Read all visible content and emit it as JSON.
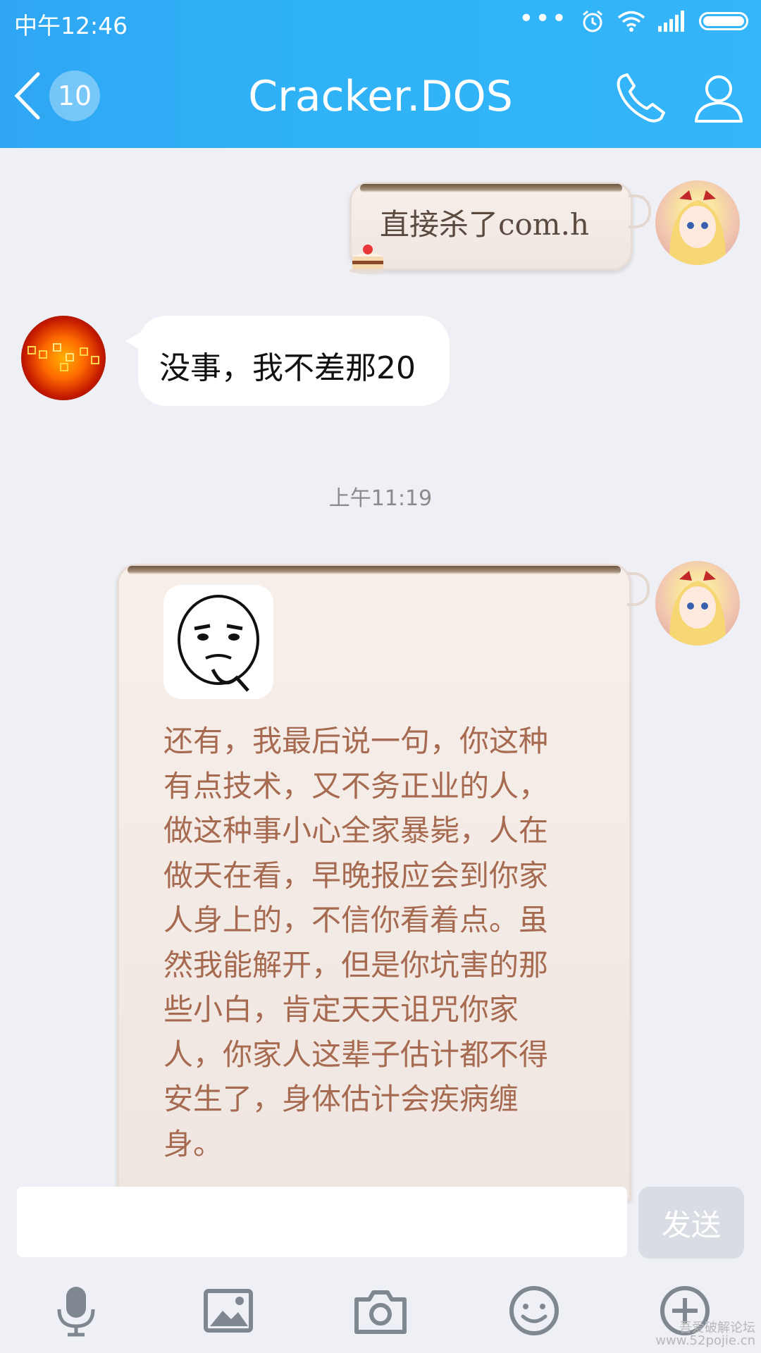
{
  "status_bar": {
    "time": "中午12:46"
  },
  "header": {
    "back_count": "10",
    "title": "Cracker.DOS"
  },
  "messages": [
    {
      "side": "right",
      "text": "直接杀了com.h"
    },
    {
      "side": "left",
      "text": "没事，我不差那20"
    },
    {
      "type": "timestamp",
      "text": "上午11:19"
    },
    {
      "side": "right",
      "text": "还有，我最后说一句，你这种有点技术，又不务正业的人，做这种事小心全家暴毙，人在做天在看，早晚报应会到你家人身上的，不信你看着点。虽然我能解开，但是你坑害的那些小白，肯定天天诅咒你家人，你家人这辈子估计都不得安生了，身体估计会疾病缠身。"
    }
  ],
  "input": {
    "placeholder": "",
    "send_label": "发送"
  },
  "toolbar": [
    "microphone-icon",
    "image-icon",
    "camera-icon",
    "emoji-icon",
    "plus-icon"
  ],
  "watermark": {
    "line1": "吾爱破解论坛",
    "line2": "www.52pojie.cn"
  },
  "colors": {
    "header": "#2fb3f6",
    "brown_text": "#a66a50",
    "background": "#eef0f6"
  }
}
